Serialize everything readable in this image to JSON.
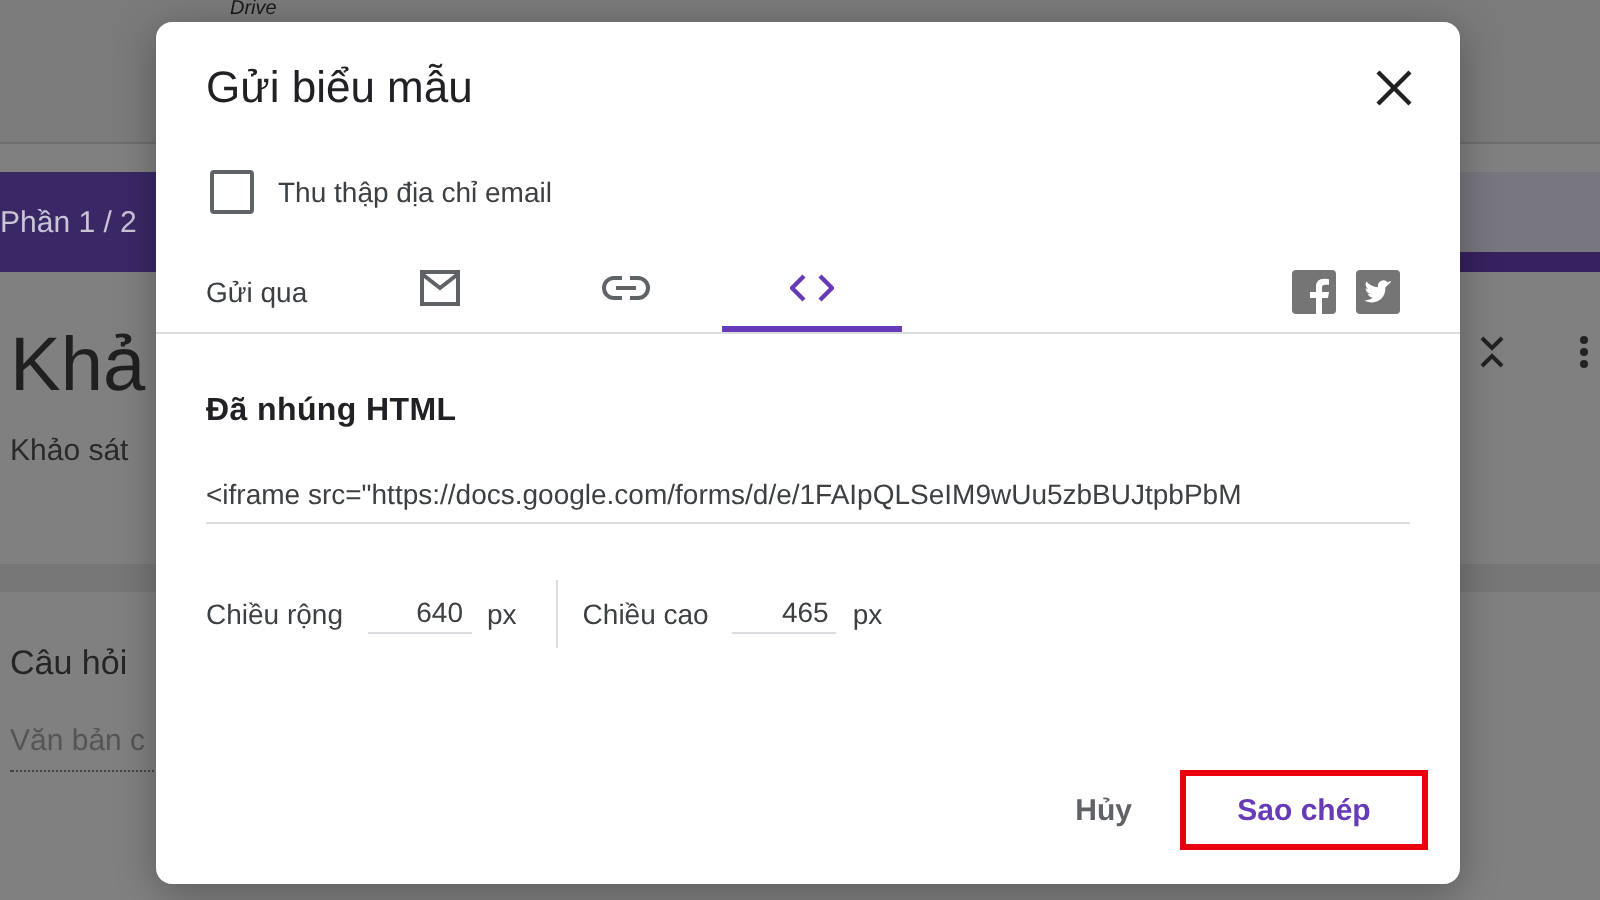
{
  "background": {
    "drive_label": "Drive",
    "section_tab": "Phần 1 / 2",
    "form_title": "Khả",
    "form_description": "Khảo sát",
    "question_title": "Câu hỏi",
    "answer_hint": "Văn bản c"
  },
  "dialog": {
    "title": "Gửi biểu mẫu",
    "collect_email": {
      "label": "Thu thập địa chỉ email",
      "checked": false
    },
    "send_via_label": "Gửi qua",
    "tabs": [
      {
        "kind": "email",
        "selected": false
      },
      {
        "kind": "link",
        "selected": false
      },
      {
        "kind": "embed",
        "selected": true
      }
    ],
    "embed": {
      "heading": "Đã nhúng HTML",
      "code": "<iframe src=\"https://docs.google.com/forms/d/e/1FAIpQLSeIM9wUu5zbBUJtpbPbM",
      "width_label": "Chiều rộng",
      "width_value": "640",
      "width_unit": "px",
      "height_label": "Chiều cao",
      "height_value": "465",
      "height_unit": "px"
    },
    "buttons": [
      {
        "kind": "cancel",
        "label": "Hủy"
      },
      {
        "kind": "copy",
        "label": "Sao chép"
      }
    ]
  }
}
